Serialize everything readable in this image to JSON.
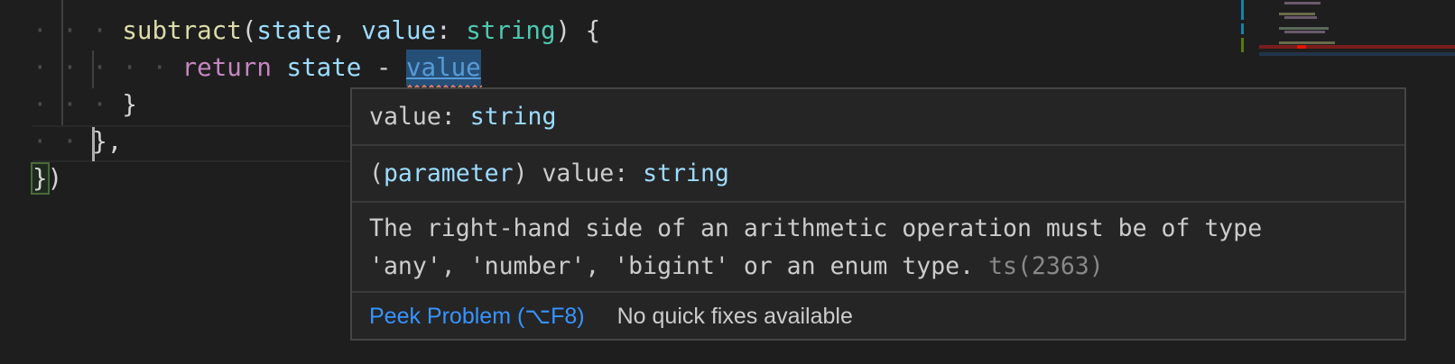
{
  "editor": {
    "lines": [
      {
        "indent": "· · · ",
        "fn": "subtract",
        "p1": "(",
        "a1": "state",
        "c1": ", ",
        "a2": "value",
        "c2": ": ",
        "t": "string",
        "c3": ") {"
      },
      {
        "indent": "· · · · · ",
        "kw": "return",
        "sp": " ",
        "v": "state",
        "op": " - ",
        "err": "value"
      },
      {
        "indent": "· · · ",
        "text": "}"
      },
      {
        "indent": "· · ",
        "text": "},"
      },
      {
        "b": "}",
        "text": ")"
      }
    ]
  },
  "hover": {
    "signature_name": "value: ",
    "signature_type": "string",
    "param_open": "(",
    "param_kw": "parameter",
    "param_close": ") value: ",
    "param_type": "string",
    "message_line1": "The right-hand side of an arithmetic operation must be of type",
    "message_line2": "'any', 'number', 'bigint' or an enum type. ",
    "error_code": "ts(2363)",
    "peek_problem": "Peek Problem (⌥F8)",
    "no_quick_fixes": "No quick fixes available"
  },
  "colors": {
    "error": "#f14c4c",
    "link": "#3794ff"
  }
}
